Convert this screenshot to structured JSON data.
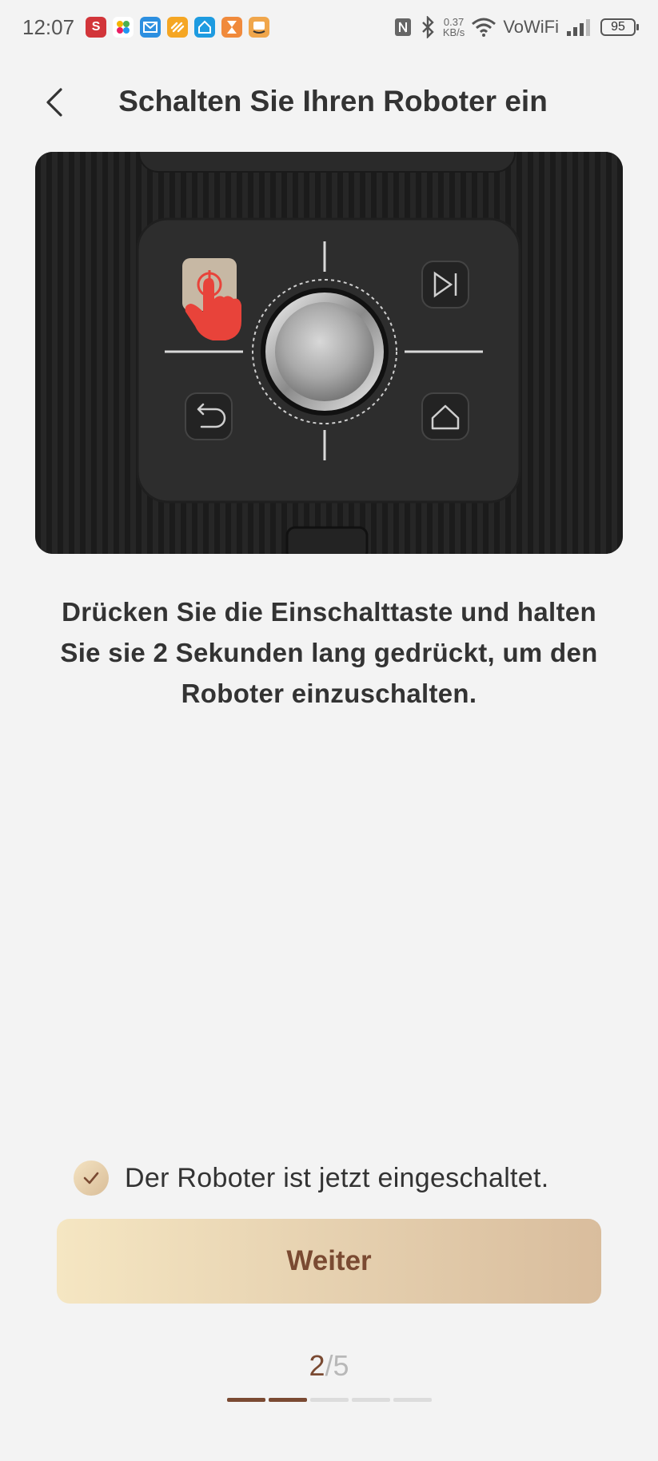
{
  "status_bar": {
    "time": "12:07",
    "net_speed_value": "0.37",
    "net_speed_unit": "KB/s",
    "wifi_label": "VoWiFi",
    "battery": "95",
    "app_icons": [
      "s-app-icon",
      "pinwheel-app-icon",
      "mail-app-icon",
      "link-app-icon",
      "home-app-icon",
      "hourglass-app-icon",
      "amazon-app-icon"
    ]
  },
  "header": {
    "title": "Schalten Sie Ihren Roboter ein",
    "back_icon": "chevron-left-icon"
  },
  "illustration": {
    "subject": "robot-control-panel",
    "highlight_color": "#e8433a"
  },
  "instruction": {
    "line1": "Drücken Sie die Einschalttaste und halten",
    "line2": "Sie sie 2 Sekunden lang gedrückt, um den",
    "line3": "Roboter einzuschalten."
  },
  "confirmation": {
    "checked": true,
    "label": "Der Roboter ist jetzt eingeschaltet."
  },
  "next_button": {
    "label": "Weiter"
  },
  "step_indicator": {
    "current": "2",
    "separator": "/",
    "total": "5",
    "progress_segments": 5,
    "progress_filled": 2
  },
  "colors": {
    "background": "#f3f3f3",
    "accent_brown": "#7a4a32",
    "button_gradient_start": "#f5e6c2",
    "button_gradient_end": "#d9bd9d"
  }
}
